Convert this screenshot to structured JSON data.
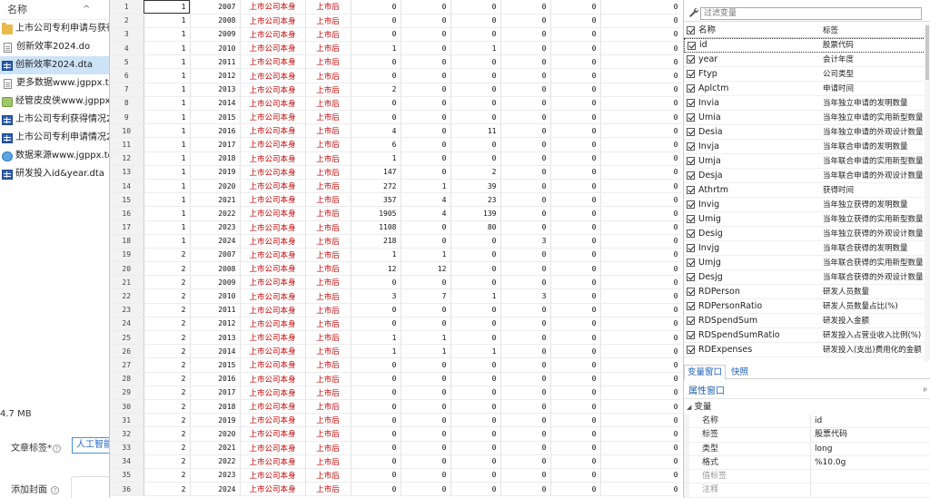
{
  "explorer": {
    "header": "名称",
    "files": [
      {
        "icon": "folder-icon",
        "name": "上市公司专利申请与获得"
      },
      {
        "icon": "document-icon",
        "name": "创新效率2024.do"
      },
      {
        "icon": "dta-file-icon",
        "name": "创新效率2024.dta",
        "selected": true
      },
      {
        "icon": "document-icon",
        "name": "更多数据www.jgppx.top.t"
      },
      {
        "icon": "package-icon",
        "name": "经管皮皮侠www.jgppx.top"
      },
      {
        "icon": "dta-file-icon",
        "name": "上市公司专利获得情况202"
      },
      {
        "icon": "dta-file-icon",
        "name": "上市公司专利申请情况202"
      },
      {
        "icon": "html-file-icon",
        "name": "数据来源www.jgppx.top.l"
      },
      {
        "icon": "dta-file-icon",
        "name": "研发投入id&year.dta"
      }
    ],
    "size": "4.7 MB",
    "tag_label": "文章标签*",
    "tag_button": "人工智能",
    "cover_label": "添加封面"
  },
  "grid": {
    "rows": [
      [
        "1",
        "1",
        "2007",
        "上市公司本身",
        "上市后",
        "0",
        "0",
        "0",
        "0",
        "0",
        "0"
      ],
      [
        "2",
        "1",
        "2008",
        "上市公司本身",
        "上市后",
        "0",
        "0",
        "0",
        "0",
        "0",
        "0"
      ],
      [
        "3",
        "1",
        "2009",
        "上市公司本身",
        "上市后",
        "0",
        "0",
        "0",
        "0",
        "0",
        "0"
      ],
      [
        "4",
        "1",
        "2010",
        "上市公司本身",
        "上市后",
        "1",
        "0",
        "1",
        "0",
        "0",
        "0"
      ],
      [
        "5",
        "1",
        "2011",
        "上市公司本身",
        "上市后",
        "0",
        "0",
        "0",
        "0",
        "0",
        "0"
      ],
      [
        "6",
        "1",
        "2012",
        "上市公司本身",
        "上市后",
        "0",
        "0",
        "0",
        "0",
        "0",
        "0"
      ],
      [
        "7",
        "1",
        "2013",
        "上市公司本身",
        "上市后",
        "2",
        "0",
        "0",
        "0",
        "0",
        "0"
      ],
      [
        "8",
        "1",
        "2014",
        "上市公司本身",
        "上市后",
        "0",
        "0",
        "0",
        "0",
        "0",
        "0"
      ],
      [
        "9",
        "1",
        "2015",
        "上市公司本身",
        "上市后",
        "0",
        "0",
        "0",
        "0",
        "0",
        "0"
      ],
      [
        "10",
        "1",
        "2016",
        "上市公司本身",
        "上市后",
        "4",
        "0",
        "11",
        "0",
        "0",
        "0"
      ],
      [
        "11",
        "1",
        "2017",
        "上市公司本身",
        "上市后",
        "6",
        "0",
        "0",
        "0",
        "0",
        "0"
      ],
      [
        "12",
        "1",
        "2018",
        "上市公司本身",
        "上市后",
        "1",
        "0",
        "0",
        "0",
        "0",
        "0"
      ],
      [
        "13",
        "1",
        "2019",
        "上市公司本身",
        "上市后",
        "147",
        "0",
        "2",
        "0",
        "0",
        "0"
      ],
      [
        "14",
        "1",
        "2020",
        "上市公司本身",
        "上市后",
        "272",
        "1",
        "39",
        "0",
        "0",
        "0"
      ],
      [
        "15",
        "1",
        "2021",
        "上市公司本身",
        "上市后",
        "357",
        "4",
        "23",
        "0",
        "0",
        "0"
      ],
      [
        "16",
        "1",
        "2022",
        "上市公司本身",
        "上市后",
        "1905",
        "4",
        "139",
        "0",
        "0",
        "0"
      ],
      [
        "17",
        "1",
        "2023",
        "上市公司本身",
        "上市后",
        "1108",
        "0",
        "80",
        "0",
        "0",
        "0"
      ],
      [
        "18",
        "1",
        "2024",
        "上市公司本身",
        "上市后",
        "218",
        "0",
        "0",
        "3",
        "0",
        "0"
      ],
      [
        "19",
        "2",
        "2007",
        "上市公司本身",
        "上市后",
        "1",
        "1",
        "0",
        "0",
        "0",
        "0"
      ],
      [
        "20",
        "2",
        "2008",
        "上市公司本身",
        "上市后",
        "12",
        "12",
        "0",
        "0",
        "0",
        "0"
      ],
      [
        "21",
        "2",
        "2009",
        "上市公司本身",
        "上市后",
        "0",
        "0",
        "0",
        "0",
        "0",
        "0"
      ],
      [
        "22",
        "2",
        "2010",
        "上市公司本身",
        "上市后",
        "3",
        "7",
        "1",
        "3",
        "0",
        "0"
      ],
      [
        "23",
        "2",
        "2011",
        "上市公司本身",
        "上市后",
        "0",
        "0",
        "0",
        "0",
        "0",
        "0"
      ],
      [
        "24",
        "2",
        "2012",
        "上市公司本身",
        "上市后",
        "0",
        "0",
        "0",
        "0",
        "0",
        "0"
      ],
      [
        "25",
        "2",
        "2013",
        "上市公司本身",
        "上市后",
        "1",
        "1",
        "0",
        "0",
        "0",
        "0"
      ],
      [
        "26",
        "2",
        "2014",
        "上市公司本身",
        "上市后",
        "1",
        "1",
        "1",
        "0",
        "0",
        "0"
      ],
      [
        "27",
        "2",
        "2015",
        "上市公司本身",
        "上市后",
        "0",
        "0",
        "0",
        "0",
        "0",
        "0"
      ],
      [
        "28",
        "2",
        "2016",
        "上市公司本身",
        "上市后",
        "0",
        "0",
        "0",
        "0",
        "0",
        "0"
      ],
      [
        "29",
        "2",
        "2017",
        "上市公司本身",
        "上市后",
        "0",
        "0",
        "0",
        "0",
        "0",
        "0"
      ],
      [
        "30",
        "2",
        "2018",
        "上市公司本身",
        "上市后",
        "0",
        "0",
        "0",
        "0",
        "0",
        "0"
      ],
      [
        "31",
        "2",
        "2019",
        "上市公司本身",
        "上市后",
        "0",
        "0",
        "0",
        "0",
        "0",
        "0"
      ],
      [
        "32",
        "2",
        "2020",
        "上市公司本身",
        "上市后",
        "0",
        "0",
        "0",
        "0",
        "0",
        "0"
      ],
      [
        "33",
        "2",
        "2021",
        "上市公司本身",
        "上市后",
        "0",
        "0",
        "0",
        "0",
        "0",
        "0"
      ],
      [
        "34",
        "2",
        "2022",
        "上市公司本身",
        "上市后",
        "0",
        "0",
        "0",
        "0",
        "0",
        "0"
      ],
      [
        "35",
        "2",
        "2023",
        "上市公司本身",
        "上市后",
        "0",
        "0",
        "0",
        "0",
        "0",
        "0"
      ],
      [
        "36",
        "2",
        "2024",
        "上市公司本身",
        "上市后",
        "0",
        "0",
        "0",
        "0",
        "0",
        "0"
      ]
    ]
  },
  "variables": {
    "filter_placeholder": "过滤变量",
    "header": {
      "name": "名称",
      "label": "标签"
    },
    "items": [
      {
        "name": "id",
        "label": "股票代码"
      },
      {
        "name": "year",
        "label": "会计年度"
      },
      {
        "name": "Ftyp",
        "label": "公司类型"
      },
      {
        "name": "Aplctm",
        "label": "申请时间"
      },
      {
        "name": "Invia",
        "label": "当年独立申请的发明数量"
      },
      {
        "name": "Umia",
        "label": "当年独立申请的实用新型数量"
      },
      {
        "name": "Desia",
        "label": "当年独立申请的外观设计数量"
      },
      {
        "name": "Invja",
        "label": "当年联合申请的发明数量"
      },
      {
        "name": "Umja",
        "label": "当年联合申请的实用新型数量"
      },
      {
        "name": "Desja",
        "label": "当年联合申请的外观设计数量"
      },
      {
        "name": "Athrtm",
        "label": "获得时间"
      },
      {
        "name": "Invig",
        "label": "当年独立获得的发明数量"
      },
      {
        "name": "Umig",
        "label": "当年独立获得的实用新型数量"
      },
      {
        "name": "Desig",
        "label": "当年独立获得的外观设计数量"
      },
      {
        "name": "Invjg",
        "label": "当年联合获得的发明数量"
      },
      {
        "name": "Umjg",
        "label": "当年联合获得的实用新型数量"
      },
      {
        "name": "Desjg",
        "label": "当年联合获得的外观设计数量"
      },
      {
        "name": "RDPerson",
        "label": "研发人员数量"
      },
      {
        "name": "RDPersonRatio",
        "label": "研发人员数量占比(%)"
      },
      {
        "name": "RDSpendSum",
        "label": "研发投入金额"
      },
      {
        "name": "RDSpendSumRatio",
        "label": "研发投入占营业收入比例(%)"
      },
      {
        "name": "RDExpenses",
        "label": "研发投入(支出)费用化的金额"
      }
    ]
  },
  "tabs": [
    "变量窗口",
    "快照"
  ],
  "properties": {
    "title": "属性窗口",
    "pin_glyph": "ᵖ",
    "group": "变量",
    "rows": [
      {
        "key": "名称",
        "value": "id"
      },
      {
        "key": "标签",
        "value": "股票代码"
      },
      {
        "key": "类型",
        "value": "long"
      },
      {
        "key": "格式",
        "value": "%10.0g"
      },
      {
        "key": "值标签",
        "value": ""
      },
      {
        "key": "注释",
        "value": ""
      }
    ]
  }
}
